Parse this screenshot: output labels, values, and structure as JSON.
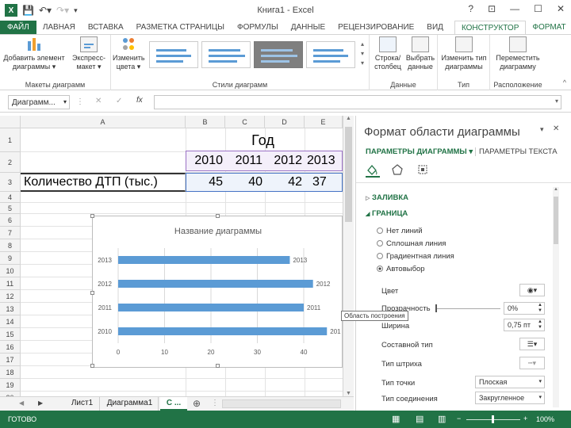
{
  "window": {
    "title": "Книга1 - Excel",
    "help": "?",
    "minimize": "—",
    "restore": "☐",
    "close": "✕",
    "ribbon_opts": "⊡"
  },
  "tabs": [
    {
      "label": "ФАЙЛ"
    },
    {
      "label": "ЛАВНАЯ"
    },
    {
      "label": "ВСТАВКА"
    },
    {
      "label": "РАЗМЕТКА СТРАНИЦЫ"
    },
    {
      "label": "ФОРМУЛЫ"
    },
    {
      "label": "ДАННЫЕ"
    },
    {
      "label": "РЕЦЕНЗИРОВАНИЕ"
    },
    {
      "label": "ВИД"
    },
    {
      "label": "КОНСТРУКТОР"
    },
    {
      "label": "ФОРМАТ"
    }
  ],
  "ribbon": {
    "add_element": "Добавить элемент диаграммы ▾",
    "express_layout": "Экспресс-макет ▾",
    "group_layouts": "Макеты диаграмм",
    "change_colors": "Изменить цвета ▾",
    "group_styles": "Стили диаграмм",
    "row_col": "Строка/столбец",
    "select_data": "Выбрать данные",
    "group_data": "Данные",
    "change_type": "Изменить тип диаграммы",
    "group_type": "Тип",
    "move_chart": "Переместить диаграмму",
    "group_location": "Расположение"
  },
  "formula_bar": {
    "name_box": "Диаграмм...",
    "cancel": "✕",
    "enter": "✓",
    "fx": "fx",
    "formula": ""
  },
  "grid": {
    "columns": [
      "A",
      "B",
      "C",
      "D",
      "E"
    ],
    "rows": [
      "1",
      "2",
      "3",
      "4",
      "5",
      "6",
      "7",
      "8",
      "9",
      "10",
      "11",
      "12",
      "13",
      "14",
      "15",
      "16",
      "17",
      "18",
      "19",
      "20"
    ],
    "header_merged": "Год",
    "years": [
      "2010",
      "2011",
      "2012",
      "2013"
    ],
    "row_label": "Количество ДТП (тыс.)",
    "values": [
      "45",
      "40",
      "42",
      "37"
    ]
  },
  "chart_data": {
    "type": "bar",
    "title": "Название диаграммы",
    "categories": [
      "2013",
      "2012",
      "2011",
      "2010"
    ],
    "values": [
      37,
      42,
      40,
      45
    ],
    "data_labels": [
      "2013",
      "2012",
      "2011",
      "201"
    ],
    "xlim": [
      0,
      40
    ],
    "xticks": [
      "0",
      "10",
      "20",
      "30",
      "40"
    ],
    "grid": true,
    "bar_color": "#5b9bd5"
  },
  "tooltip": "Область построения",
  "pane": {
    "title": "Формат области диаграммы",
    "pin": "▾",
    "close": "✕",
    "tab_chart": "ПАРАМЕТРЫ ДИАГРАММЫ",
    "tab_text": "ПАРАМЕТРЫ ТЕКСТА",
    "section_fill": "ЗАЛИВКА",
    "section_border": "ГРАНИЦА",
    "radio": [
      "Нет линий",
      "Сплошная линия",
      "Градиентная линия",
      "Автовыбор"
    ],
    "color": "Цвет",
    "transparency": "Прозрачность",
    "transparency_value": "0%",
    "width": "Ширина",
    "width_value": "0,75 пт",
    "compound": "Составной тип",
    "dash": "Тип штриха",
    "cap": "Тип точки",
    "cap_value": "Плоская",
    "join": "Тип соединения",
    "join_value": "Закругленное"
  },
  "sheets": {
    "tab1": "Лист1",
    "tab2": "Диаграмма1",
    "tab3": "С ...",
    "add": "⊕"
  },
  "status": {
    "ready": "ГОТОВО",
    "zoom": "100%"
  },
  "colors": {
    "excel_green": "#217346",
    "accent": "#5b9bd5",
    "selection": "#9b72c6"
  }
}
